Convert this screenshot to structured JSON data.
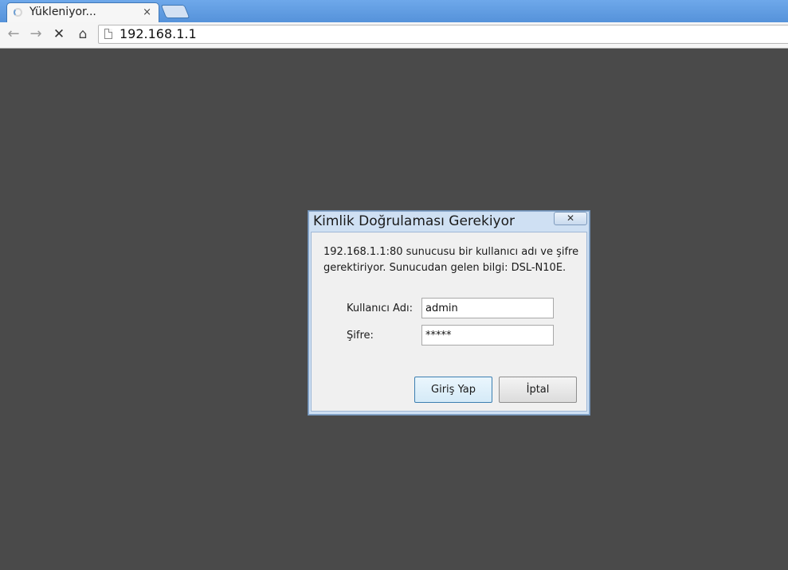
{
  "browser": {
    "tab": {
      "title": "Yükleniyor...",
      "close_glyph": "×",
      "loading_icon": "loading-spinner-icon"
    },
    "new_tab_icon": "new-tab-icon",
    "nav": {
      "back_glyph": "←",
      "forward_glyph": "→",
      "stop_glyph": "✕",
      "home_glyph": "⌂"
    },
    "address_bar": {
      "url": "192.168.1.1",
      "page_icon": "page-icon"
    }
  },
  "dialog": {
    "title": "Kimlik Doğrulaması Gerekiyor",
    "close_glyph": "✕",
    "message": "192.168.1.1:80 sunucusu bir kullanıcı adı ve şifre gerektiriyor. Sunucudan gelen bilgi: DSL-N10E.",
    "username_label": "Kullanıcı Adı:",
    "username_value": "admin",
    "password_label": "Şifre:",
    "password_value": "*****",
    "login_button": "Giriş Yap",
    "cancel_button": "İptal"
  },
  "colors": {
    "page_background": "#4a4a4a",
    "tabstrip": "#5e9be0",
    "dialog_frame": "#cfe0f3"
  }
}
